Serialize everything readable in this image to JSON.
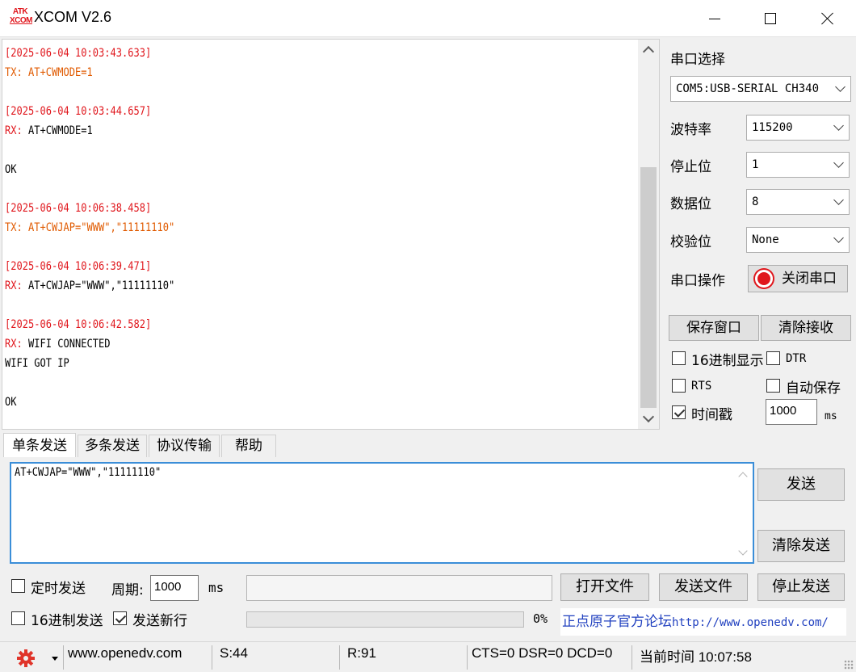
{
  "window": {
    "logo_top": "ATK",
    "logo_bottom": "XCOM",
    "title": "XCOM V2.6"
  },
  "receive": {
    "log": [
      {
        "kind": "ts",
        "text": "[2025-06-04 10:03:43.633]"
      },
      {
        "kind": "tx",
        "label": "TX:",
        "text": " AT+CWMODE=1"
      },
      {
        "kind": "blank",
        "text": ""
      },
      {
        "kind": "ts",
        "text": "[2025-06-04 10:03:44.657]"
      },
      {
        "kind": "rx",
        "label": "RX:",
        "text": " AT+CWMODE=1"
      },
      {
        "kind": "blank",
        "text": ""
      },
      {
        "kind": "plain",
        "text": "OK"
      },
      {
        "kind": "blank",
        "text": ""
      },
      {
        "kind": "ts",
        "text": "[2025-06-04 10:06:38.458]"
      },
      {
        "kind": "tx",
        "label": "TX:",
        "text": " AT+CWJAP=\"WWW\",\"11111110\""
      },
      {
        "kind": "blank",
        "text": ""
      },
      {
        "kind": "ts",
        "text": "[2025-06-04 10:06:39.471]"
      },
      {
        "kind": "rx",
        "label": "RX:",
        "text": " AT+CWJAP=\"WWW\",\"11111110\""
      },
      {
        "kind": "blank",
        "text": ""
      },
      {
        "kind": "ts",
        "text": "[2025-06-04 10:06:42.582]"
      },
      {
        "kind": "rx",
        "label": "RX:",
        "text": " WIFI CONNECTED"
      },
      {
        "kind": "plain",
        "text": "WIFI GOT IP"
      },
      {
        "kind": "blank",
        "text": ""
      },
      {
        "kind": "plain",
        "text": "OK"
      }
    ]
  },
  "panel": {
    "port_select_label": "串口选择",
    "port_value": "COM5:USB-SERIAL CH340",
    "baud_label": "波特率",
    "baud_value": "115200",
    "stopbits_label": "停止位",
    "stopbits_value": "1",
    "databits_label": "数据位",
    "databits_value": "8",
    "parity_label": "校验位",
    "parity_value": "None",
    "port_op_label": "串口操作",
    "close_port_button": "关闭串口",
    "save_window_button": "保存窗口",
    "clear_receive_button": "清除接收",
    "hex_display_label": "16进制显示",
    "hex_display_checked": false,
    "dtr_label": "DTR",
    "dtr_checked": false,
    "rts_label": "RTS",
    "rts_checked": false,
    "autosave_label": "自动保存",
    "autosave_checked": false,
    "timestamp_label": "时间戳",
    "timestamp_checked": true,
    "timestamp_value": "1000",
    "timestamp_unit": "ms"
  },
  "tabs": [
    {
      "label": "单条发送",
      "active": true
    },
    {
      "label": "多条发送",
      "active": false
    },
    {
      "label": "协议传输",
      "active": false
    },
    {
      "label": "帮助",
      "active": false
    }
  ],
  "send": {
    "text": "AT+CWJAP=\"WWW\",\"11111110\"",
    "send_button": "发送",
    "clear_send_button": "清除发送",
    "timed_send_label": "定时发送",
    "timed_send_checked": false,
    "period_label": "周期:",
    "period_value": "1000",
    "period_unit": "ms",
    "file_path": "",
    "open_file_button": "打开文件",
    "send_file_button": "发送文件",
    "stop_send_button": "停止发送",
    "hex_send_label": "16进制发送",
    "hex_send_checked": false,
    "newline_label": "发送新行",
    "newline_checked": true,
    "progress_percent": 0,
    "progress_text": "0%",
    "forum_text": "正点原子官方论坛",
    "forum_url": "http://www.openedv.com/"
  },
  "statusbar": {
    "website": "www.openedv.com",
    "sent": "S:44",
    "received": "R:91",
    "signals": "CTS=0 DSR=0 DCD=0",
    "time": "当前时间 10:07:58"
  },
  "colors": {
    "timestamp": "#e0161c",
    "tx": "#e05a00",
    "rx_label": "#e0161c",
    "link": "#1f3fbf",
    "focus_border": "#3b8ed8"
  }
}
